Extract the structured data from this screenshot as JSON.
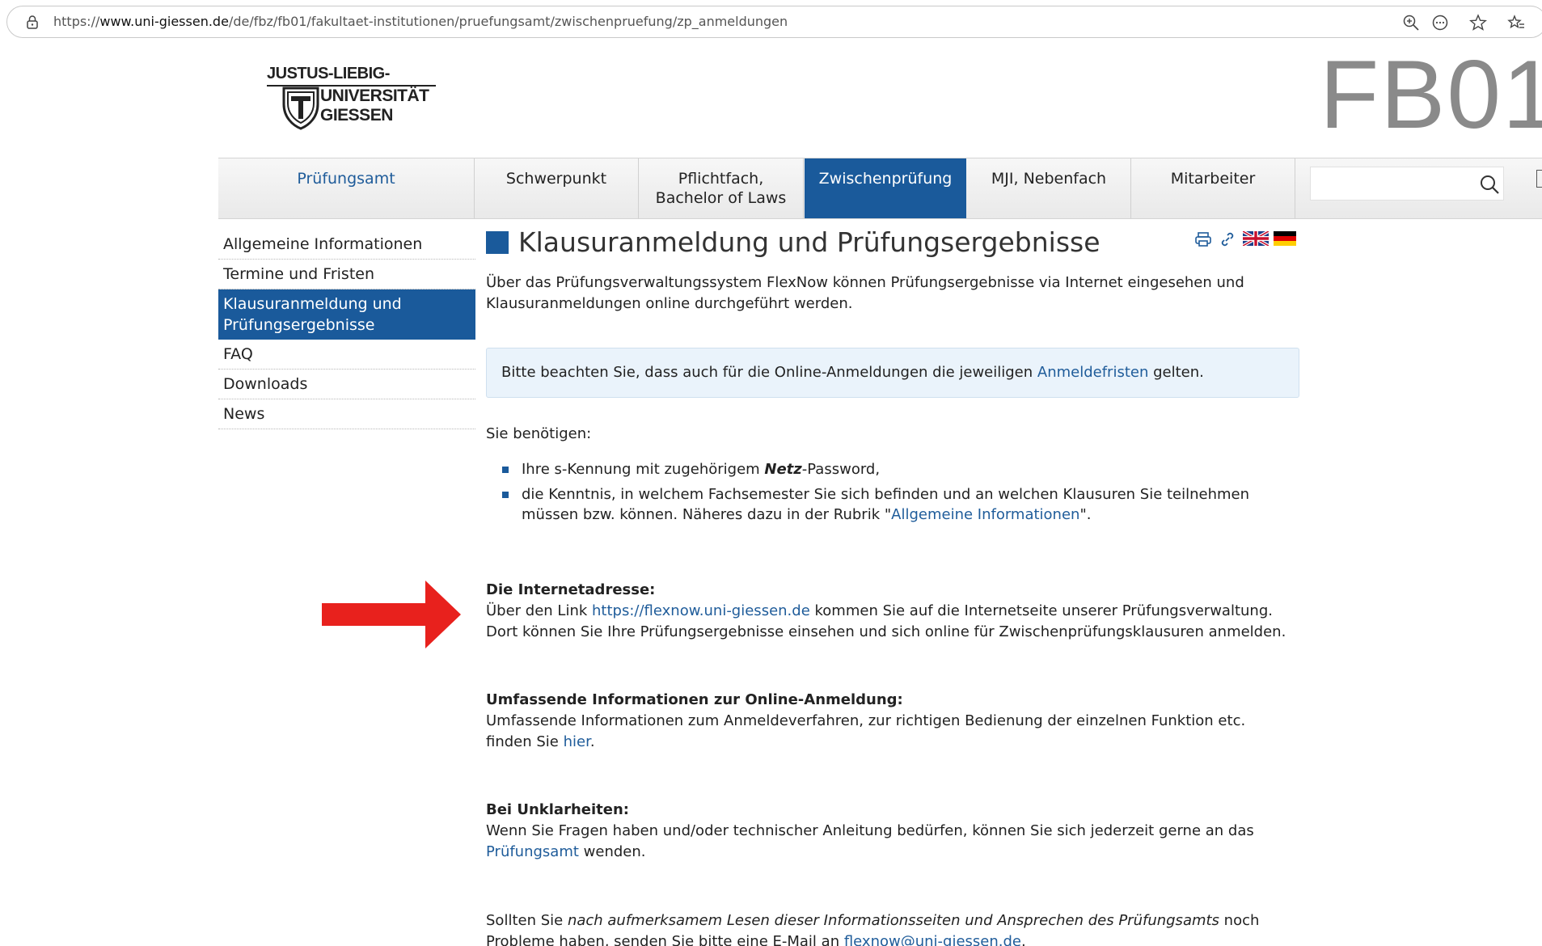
{
  "browser": {
    "url_prefix": "https://",
    "url_domain": "www.uni-giessen.de",
    "url_path": "/de/fbz/fb01/fakultaet-institutionen/pruefungsamt/zwischenpruefung/zp_anmeldungen",
    "icons": [
      "lock-icon",
      "zoom-icon",
      "reader-icon",
      "favorite-star-icon",
      "favorites-icon"
    ]
  },
  "header": {
    "logo_line1": "JUSTUS-LIEBIG-",
    "logo_line2": "UNIVERSITÄT",
    "logo_line3": "GIESSEN",
    "faculty": "FB01"
  },
  "nav": {
    "items": [
      {
        "label": "Prüfungsamt"
      },
      {
        "label": "Schwerpunkt"
      },
      {
        "label_1": "Pflichtfach,",
        "label_2": "Bachelor of Laws"
      },
      {
        "label": "Zwischenprüfung"
      },
      {
        "label": "MJI, Nebenfach"
      },
      {
        "label": "Mitarbeiter"
      }
    ],
    "search_placeholder": ""
  },
  "sidebar": {
    "items": [
      {
        "label": "Allgemeine Informationen"
      },
      {
        "label": "Termine und Fristen"
      },
      {
        "label": "Klausuranmeldung und Prüfungsergebnisse"
      },
      {
        "label": "FAQ"
      },
      {
        "label": "Downloads"
      },
      {
        "label": "News"
      }
    ]
  },
  "main": {
    "title": "Klausuranmeldung und Prüfungsergebnisse",
    "intro": "Über das Prüfungsverwaltungssystem FlexNow können Prüfungsergebnisse via Internet eingesehen und Klausuranmeldungen online durchgeführt werden.",
    "notice_before": "Bitte beachten Sie, dass auch für die Online-Anmeldungen die jeweiligen ",
    "notice_link": "Anmeldefristen",
    "notice_after": " gelten.",
    "needs_label": "Sie benötigen:",
    "bullet1_before": "Ihre s-Kennung mit zugehörigem ",
    "bullet1_bold": "Netz",
    "bullet1_after": "-Password,",
    "bullet2_before": "die Kenntnis, in welchem Fachsemester Sie sich befinden und an welchen Klausuren Sie teilnehmen müssen bzw. können. Näheres dazu in der Rubrik \"",
    "bullet2_link": "Allgemeine Informationen",
    "bullet2_after": "\".",
    "s1_heading": "Die Internetadresse:",
    "s1_before": "Über den Link ",
    "s1_link": "https://flexnow.uni-giessen.de",
    "s1_after": " kommen Sie auf die Internetseite unserer Prüfungsverwaltung. Dort können Sie Ihre Prüfungsergebnisse einsehen und sich online für Zwischenprüfungsklausuren anmelden.",
    "s2_heading": "Umfassende Informationen zur Online-Anmeldung:",
    "s2_before": "Umfassende Informationen zum Anmeldeverfahren, zur richtigen Bedienung der einzelnen Funktion etc. finden Sie ",
    "s2_link": "hier",
    "s2_after": ".",
    "s3_heading": "Bei Unklarheiten:",
    "s3_before": "Wenn Sie Fragen haben und/oder technischer Anleitung bedürfen, können Sie sich jederzeit gerne an das ",
    "s3_link": "Prüfungsamt",
    "s3_after": " wenden.",
    "s4_before": "Sollten Sie ",
    "s4_italic": "nach aufmerksamem Lesen dieser Informationsseiten und Ansprechen des Prüfungsamts",
    "s4_middle": " noch Probleme haben, senden Sie bitte eine E-Mail an ",
    "s4_link": "flexnow@uni-giessen.de",
    "s4_after": "."
  },
  "colors": {
    "accent": "#1a5a9b",
    "link": "#1f5c9a",
    "annotation_arrow": "#e8211d"
  }
}
